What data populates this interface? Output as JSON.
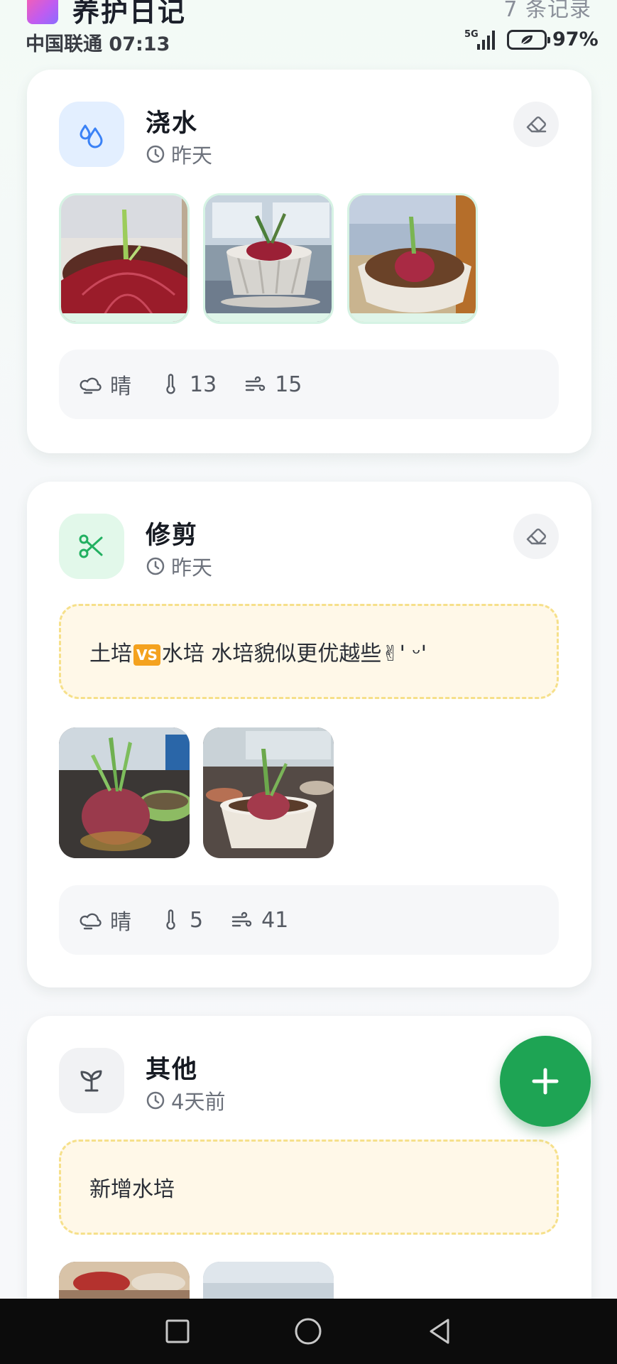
{
  "header": {
    "title": "养护日记",
    "record_count": "7 条记录"
  },
  "status_bar": {
    "carrier": "中国联通",
    "time": "07:13",
    "network": "5G",
    "battery": "97%"
  },
  "cards": [
    {
      "type": "浇水",
      "time": "昨天",
      "icon": "water-drop-icon",
      "icon_bg": "#e3efff",
      "icon_color": "#3b82f6",
      "photos": [
        "onion-closeup-photo",
        "onion-windowsill-photo",
        "onion-bowl-photo"
      ],
      "weather": {
        "condition": "晴",
        "temperature": "13",
        "wind": "15"
      }
    },
    {
      "type": "修剪",
      "time": "昨天",
      "icon": "scissors-icon",
      "icon_bg": "#e2f8ea",
      "icon_color": "#22b061",
      "note": {
        "before": "土培",
        "badge": "VS",
        "after": "水培 水培貌似更优越些✌' ᵕ'"
      },
      "photos": [
        "onion-hydroponic-photo",
        "onion-pot-photo"
      ],
      "weather": {
        "condition": "晴",
        "temperature": "5",
        "wind": "41"
      }
    },
    {
      "type": "其他",
      "time": "4天前",
      "icon": "sprout-icon",
      "icon_bg": "#f1f2f4",
      "icon_color": "#4b5058",
      "note": {
        "text": "新增水培"
      },
      "photos": [
        "bowl-photo",
        "planter-photo"
      ]
    }
  ],
  "colors": {
    "accent_green": "#1ea454",
    "note_bg": "#fff8e8",
    "note_border": "#f6e08a"
  }
}
